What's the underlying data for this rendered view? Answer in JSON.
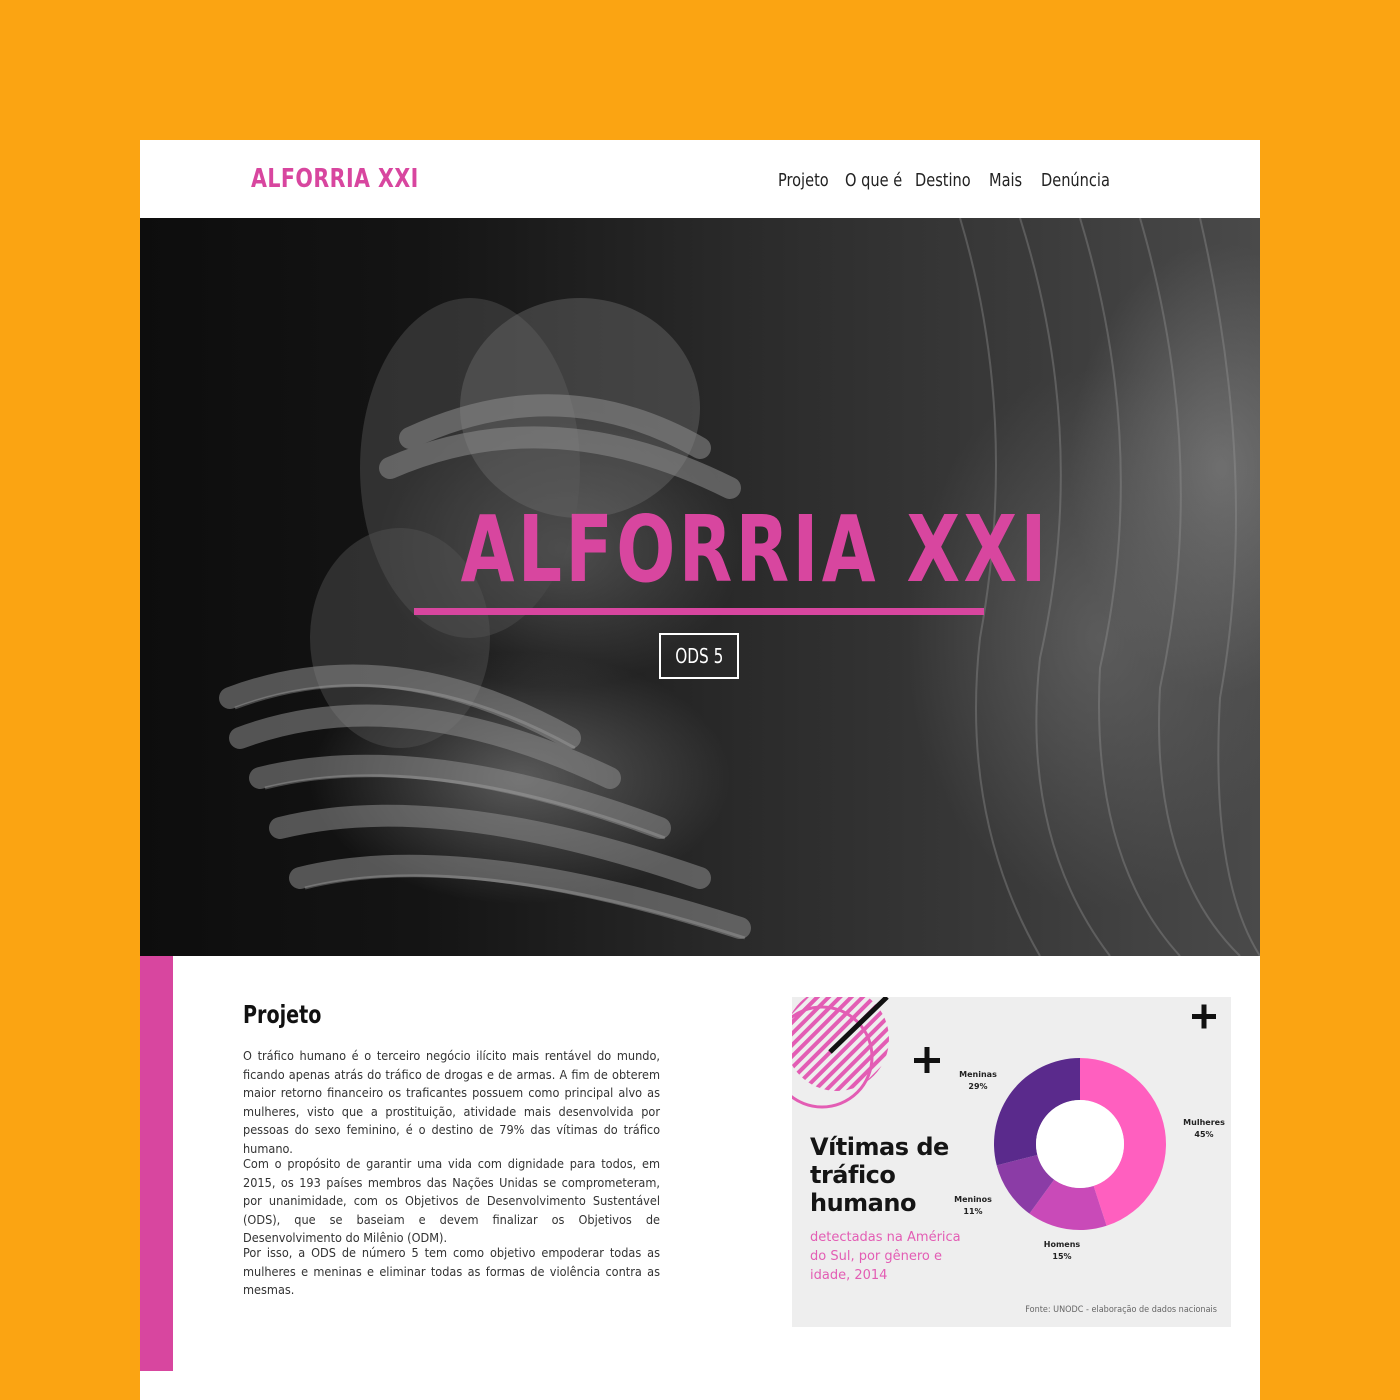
{
  "header": {
    "brand": "ALFORRIA XXI",
    "nav": [
      "Projeto",
      "O que é",
      "Destino",
      "Mais",
      "Denúncia"
    ]
  },
  "hero": {
    "title": "ALFORRIA XXI",
    "button": "ODS 5"
  },
  "project": {
    "title": "Projeto",
    "paragraphs": [
      "O tráfico humano é o terceiro negócio ilícito mais rentável do mundo, ficando apenas atrás do tráfico de drogas e de armas. A fim de obterem maior retorno financeiro os traficantes possuem como principal alvo as mulheres, visto que a prostituição, atividade mais desenvolvida por pessoas do sexo feminino, é o destino de 79% das vítimas do tráfico humano.",
      "Com o propósito de garantir uma vida com dignidade para todos, em 2015, os 193 países membros das Nações Unidas se comprometeram, por unanimidade, com os Objetivos de Desenvolvimento Sustentável (ODS), que se baseiam e devem finalizar os Objetivos de Desenvolvimento do Milênio (ODM).",
      "Por isso, a ODS de número 5 tem como objetivo empoderar todas as mulheres e meninas e eliminar todas as formas de violência contra as mesmas."
    ]
  },
  "infographic": {
    "title": "Vítimas de tráfico humano",
    "subtitle": "detectadas na América do Sul, por gênero e idade, 2014",
    "source": "Fonte: UNODC - elaboração de dados nacionais",
    "plus_symbol": "+"
  },
  "chart_data": {
    "type": "pie",
    "variant": "donut",
    "title": "Vítimas de tráfico humano",
    "subtitle": "detectadas na América do Sul, por gênero e idade, 2014",
    "series": [
      {
        "name": "Mulheres",
        "value": 45,
        "label": "45%",
        "color": "#FF5FBF"
      },
      {
        "name": "Homens",
        "value": 15,
        "label": "15%",
        "color": "#C94AB8"
      },
      {
        "name": "Meninos",
        "value": 11,
        "label": "11%",
        "color": "#8B3CA6"
      },
      {
        "name": "Meninas",
        "value": 29,
        "label": "29%",
        "color": "#5A2A8C"
      }
    ]
  },
  "colors": {
    "background": "#FBA412",
    "accent": "#D8469F",
    "chart_pink": "#FF5FBF",
    "chart_purple": "#5A2A8C"
  }
}
